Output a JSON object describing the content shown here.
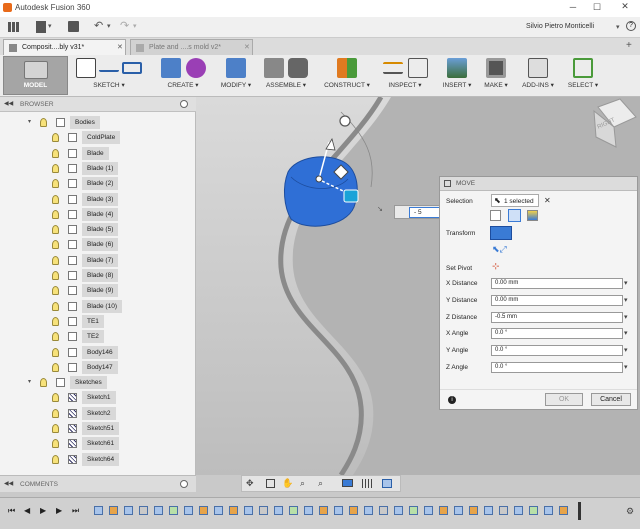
{
  "app": {
    "title": "Autodesk Fusion 360",
    "user": "Silvio Pietro Monticelli"
  },
  "tabs": [
    {
      "label": "Composit....bly v31*"
    },
    {
      "label": "Plate and ....s mold v2*"
    }
  ],
  "toolbar": {
    "model": "MODEL",
    "sketch": "SKETCH",
    "create": "CREATE",
    "modify": "MODIFY",
    "assemble": "ASSEMBLE",
    "construct": "CONSTRUCT",
    "inspect": "INSPECT",
    "insert": "INSERT",
    "make": "MAKE",
    "addins": "ADD-INS",
    "select": "SELECT"
  },
  "browser": {
    "title": "BROWSER",
    "bodies_label": "Bodies",
    "bodies": [
      "ColdPlate",
      "Blade",
      "Blade (1)",
      "Blade (2)",
      "Blade (3)",
      "Blade (4)",
      "Blade (5)",
      "Blade (6)",
      "Blade (7)",
      "Blade (8)",
      "Blade (9)",
      "Blade (10)",
      "TE1",
      "TE2",
      "Body146",
      "Body147"
    ],
    "sketches_label": "Sketches",
    "sketches": [
      "Sketch1",
      "Sketch2",
      "Sketch51",
      "Sketch61",
      "Sketch64"
    ]
  },
  "comments": "COMMENTS",
  "viewcube": "RIGHT",
  "move_value": "- 5",
  "move": {
    "title": "MOVE",
    "selection_label": "Selection",
    "selection_value": "1 selected",
    "transform_label": "Transform",
    "set_pivot_label": "Set Pivot",
    "fields": [
      {
        "label": "X Distance",
        "value": "0.00 mm"
      },
      {
        "label": "Y Distance",
        "value": "0.00 mm"
      },
      {
        "label": "Z Distance",
        "value": "-0.5 mm"
      },
      {
        "label": "X Angle",
        "value": "0.0 °"
      },
      {
        "label": "Y Angle",
        "value": "0.0 °"
      },
      {
        "label": "Z Angle",
        "value": "0.0 °"
      }
    ],
    "ok": "OK",
    "cancel": "Cancel"
  },
  "colors": {
    "accent": "#3a7bd5",
    "selected_body": "#2f6fd6",
    "toolbar_active": "#2a5fa8"
  }
}
